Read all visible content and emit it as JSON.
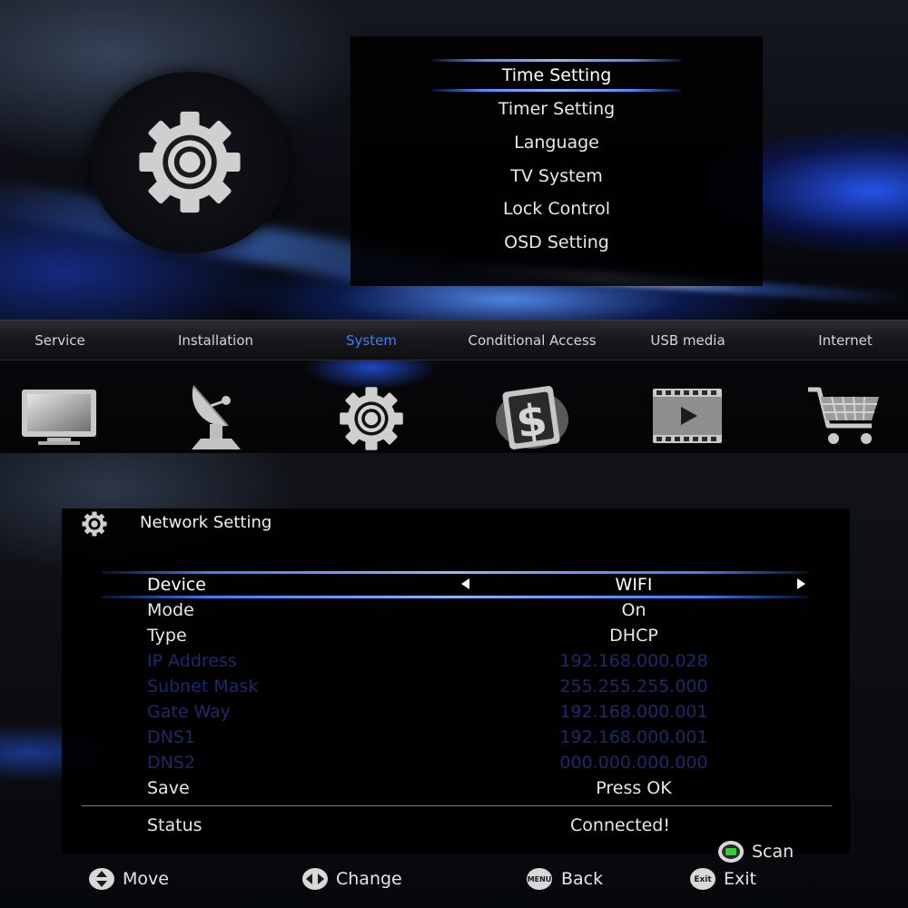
{
  "submenu": {
    "items": [
      {
        "label": "Time Setting",
        "selected": true
      },
      {
        "label": "Timer Setting",
        "selected": false
      },
      {
        "label": "Language",
        "selected": false
      },
      {
        "label": "TV System",
        "selected": false
      },
      {
        "label": "Lock Control",
        "selected": false
      },
      {
        "label": "OSD Setting",
        "selected": false
      }
    ]
  },
  "main_menu": {
    "tabs": [
      {
        "label": "Service",
        "icon": "tv-icon",
        "active": false
      },
      {
        "label": "Installation",
        "icon": "satellite-dish-icon",
        "active": false
      },
      {
        "label": "System",
        "icon": "gear-icon",
        "active": true
      },
      {
        "label": "Conditional Access",
        "icon": "card-dollar-icon",
        "active": false
      },
      {
        "label": "USB media",
        "icon": "film-play-icon",
        "active": false
      },
      {
        "label": "Internet",
        "icon": "shopping-cart-icon",
        "active": false
      }
    ]
  },
  "network_panel": {
    "title": "Network Setting",
    "rows": [
      {
        "label": "Device",
        "value": "WIFI",
        "state": "selected"
      },
      {
        "label": "Mode",
        "value": "On",
        "state": "enabled"
      },
      {
        "label": "Type",
        "value": "DHCP",
        "state": "enabled"
      },
      {
        "label": "IP Address",
        "value": "192.168.000.028",
        "state": "disabled"
      },
      {
        "label": "Subnet Mask",
        "value": "255.255.255.000",
        "state": "disabled"
      },
      {
        "label": "Gate Way",
        "value": "192.168.000.001",
        "state": "disabled"
      },
      {
        "label": "DNS1",
        "value": "192.168.000.001",
        "state": "disabled"
      },
      {
        "label": "DNS2",
        "value": "000.000.000.000",
        "state": "disabled"
      },
      {
        "label": "Save",
        "value": "Press OK",
        "state": "enabled"
      }
    ],
    "status": {
      "label": "Status",
      "value": "Connected!"
    }
  },
  "hints": {
    "scan": "Scan",
    "move": "Move",
    "change": "Change",
    "back": "Back",
    "back_key": "MENU",
    "exit": "Exit",
    "exit_key": "Exit"
  },
  "colors": {
    "accent": "#3d7dff",
    "disabled_text": "#1a2a6a",
    "scan_key": "#2fcf3a"
  }
}
